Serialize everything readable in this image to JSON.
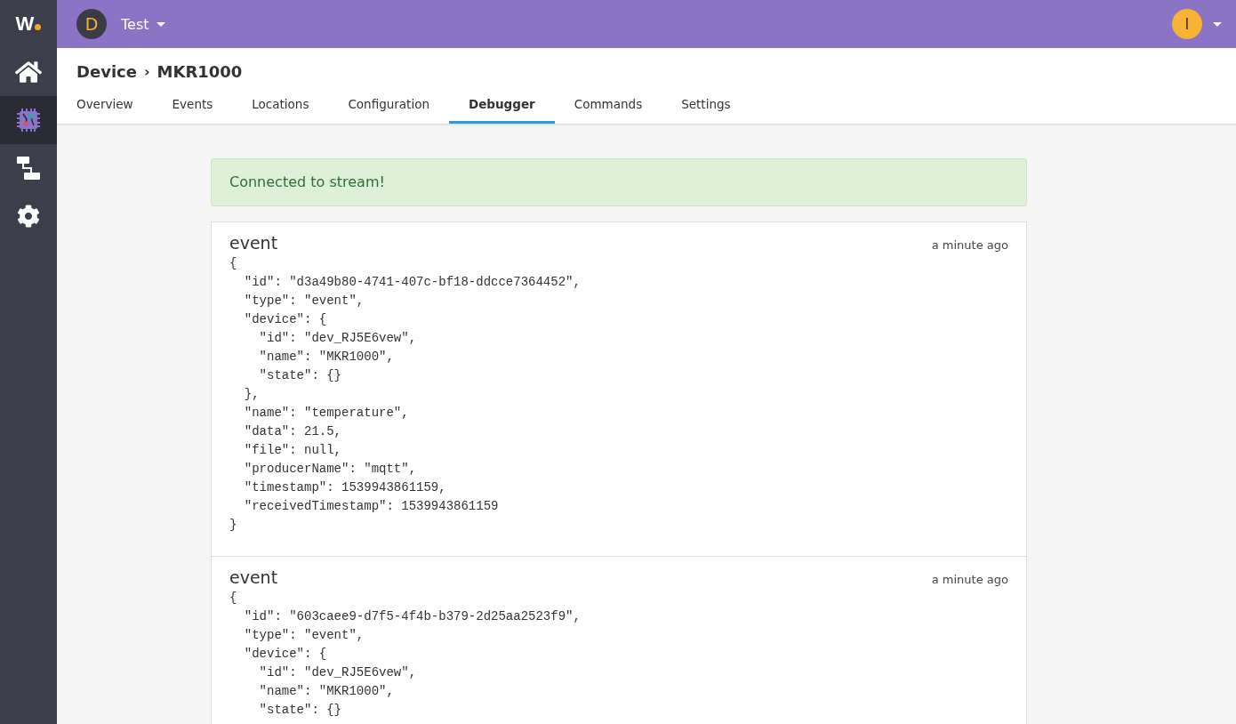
{
  "logo": "W",
  "sidebar": {
    "items": [
      {
        "kind": "home",
        "selected": false
      },
      {
        "kind": "device",
        "selected": true
      },
      {
        "kind": "flow",
        "selected": false
      },
      {
        "kind": "settings",
        "selected": false
      }
    ]
  },
  "topbar": {
    "workspace_initial": "D",
    "workspace_name": "Test",
    "user_initial": "I"
  },
  "breadcrumb": {
    "parent": "Device",
    "separator": "›",
    "current": "MKR1000"
  },
  "tabs": [
    {
      "label": "Overview",
      "selected": false
    },
    {
      "label": "Events",
      "selected": false
    },
    {
      "label": "Locations",
      "selected": false
    },
    {
      "label": "Configuration",
      "selected": false
    },
    {
      "label": "Debugger",
      "selected": true
    },
    {
      "label": "Commands",
      "selected": false
    },
    {
      "label": "Settings",
      "selected": false
    }
  ],
  "alert": "Connected to stream!",
  "events": [
    {
      "title": "event",
      "time": "a minute ago",
      "body": "{\n  \"id\": \"d3a49b80-4741-407c-bf18-ddcce7364452\",\n  \"type\": \"event\",\n  \"device\": {\n    \"id\": \"dev_RJ5E6vew\",\n    \"name\": \"MKR1000\",\n    \"state\": {}\n  },\n  \"name\": \"temperature\",\n  \"data\": 21.5,\n  \"file\": null,\n  \"producerName\": \"mqtt\",\n  \"timestamp\": 1539943861159,\n  \"receivedTimestamp\": 1539943861159\n}"
    },
    {
      "title": "event",
      "time": "a minute ago",
      "body": "{\n  \"id\": \"603caee9-d7f5-4f4b-b379-2d25aa2523f9\",\n  \"type\": \"event\",\n  \"device\": {\n    \"id\": \"dev_RJ5E6vew\",\n    \"name\": \"MKR1000\",\n    \"state\": {}"
    }
  ]
}
